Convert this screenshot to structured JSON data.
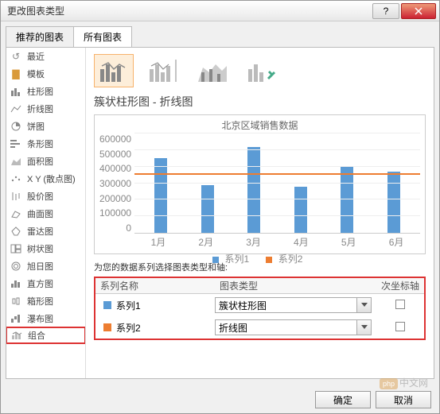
{
  "window": {
    "title": "更改图表类型"
  },
  "tabs": {
    "recommended": "推荐的图表",
    "all": "所有图表"
  },
  "sidebar": {
    "items": [
      {
        "label": "最近"
      },
      {
        "label": "模板"
      },
      {
        "label": "柱形图"
      },
      {
        "label": "折线图"
      },
      {
        "label": "饼图"
      },
      {
        "label": "条形图"
      },
      {
        "label": "面积图"
      },
      {
        "label": "X Y (散点图)"
      },
      {
        "label": "股价图"
      },
      {
        "label": "曲面图"
      },
      {
        "label": "雷达图"
      },
      {
        "label": "树状图"
      },
      {
        "label": "旭日图"
      },
      {
        "label": "直方图"
      },
      {
        "label": "箱形图"
      },
      {
        "label": "瀑布图"
      },
      {
        "label": "组合"
      }
    ]
  },
  "subtitle": "簇状柱形图 - 折线图",
  "preview": {
    "title": "北京区域销售数据",
    "legend1": "系列1",
    "legend2": "系列2"
  },
  "series_caption": "为您的数据系列选择图表类型和轴:",
  "series_head": {
    "name": "系列名称",
    "type": "图表类型",
    "secondary": "次坐标轴"
  },
  "series": [
    {
      "name": "系列1",
      "type": "簇状柱形图",
      "color": "#5b9bd5"
    },
    {
      "name": "系列2",
      "type": "折线图",
      "color": "#ed7d31"
    }
  ],
  "buttons": {
    "ok": "确定",
    "cancel": "取消"
  },
  "watermark": {
    "badge": "php",
    "text": "中文网"
  },
  "chart_data": {
    "type": "bar+line",
    "title": "北京区域销售数据",
    "categories": [
      "1月",
      "2月",
      "3月",
      "4月",
      "5月",
      "6月"
    ],
    "series": [
      {
        "name": "系列1",
        "type": "bar",
        "color": "#5b9bd5",
        "values": [
          450000,
          290000,
          520000,
          280000,
          400000,
          370000
        ]
      },
      {
        "name": "系列2",
        "type": "line",
        "color": "#ed7d31",
        "values": [
          350000,
          350000,
          350000,
          350000,
          350000,
          350000
        ]
      }
    ],
    "ylim": [
      0,
      600000
    ],
    "yticks": [
      0,
      100000,
      200000,
      300000,
      400000,
      500000,
      600000
    ]
  }
}
